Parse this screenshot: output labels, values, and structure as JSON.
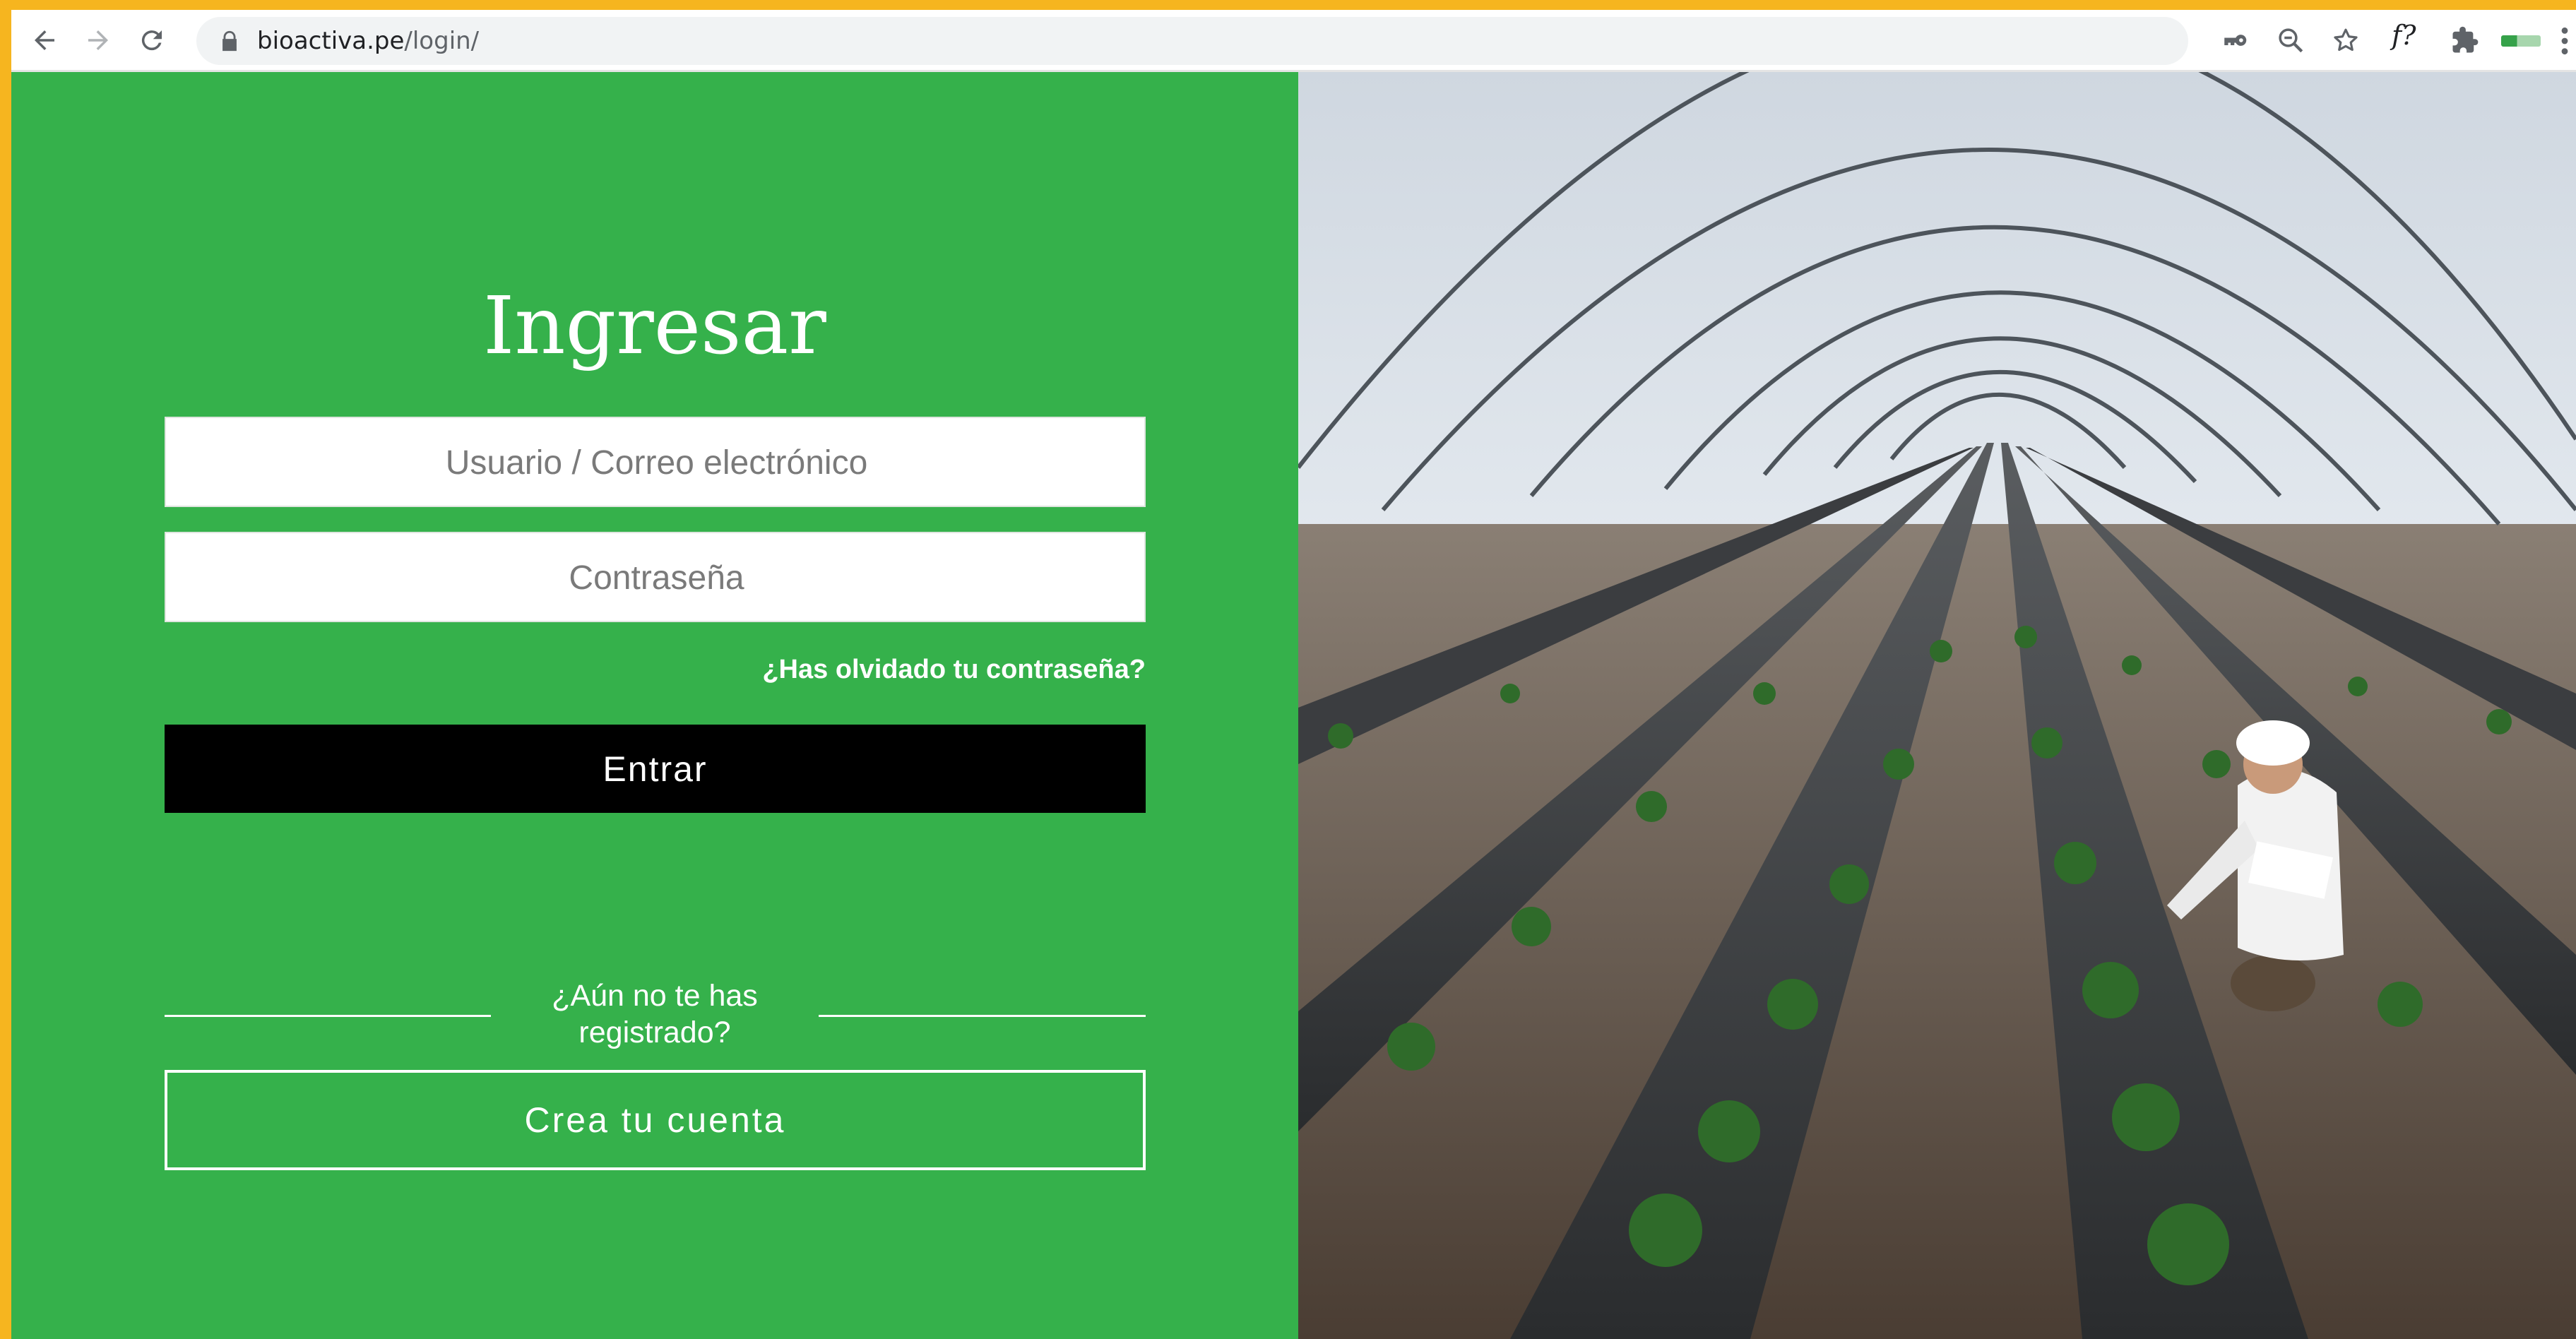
{
  "browser": {
    "url_host": "bioactiva.pe",
    "url_path": "/login/",
    "extension_label": "f?",
    "icons": [
      "back-arrow-icon",
      "forward-arrow-icon",
      "reload-icon",
      "lock-icon",
      "key-icon",
      "zoom-out-icon",
      "bookmark-star-icon",
      "extensions-puzzle-icon",
      "kebab-menu-icon"
    ]
  },
  "login": {
    "title": "Ingresar",
    "username_placeholder": "Usuario / Correo electrónico",
    "password_placeholder": "Contraseña",
    "forgot_password": "¿Has olvidado tu contraseña?",
    "submit_label": "Entrar",
    "register_prompt": "¿Aún no te has registrado?",
    "create_account_label": "Crea tu cuenta"
  },
  "colors": {
    "panel_green": "#35b14b",
    "submit_black": "#000000",
    "frame_orange": "#f6b51f"
  }
}
